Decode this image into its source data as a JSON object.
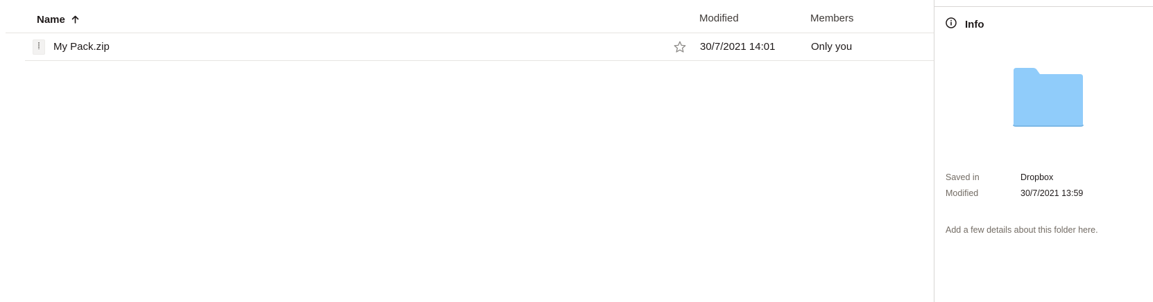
{
  "list": {
    "columns": {
      "name": "Name",
      "modified": "Modified",
      "members": "Members"
    },
    "sort": {
      "column": "name",
      "direction": "ascending",
      "icon": "arrow-up-icon"
    },
    "files": [
      {
        "name": "My Pack.zip",
        "icon": "zip-file-icon",
        "modified": "30/7/2021 14:01",
        "members": "Only you",
        "starred": false
      }
    ]
  },
  "info_panel": {
    "title": "Info",
    "title_icon": "info-icon",
    "folder_icon": "folder-icon",
    "folder_color": "#90ccfa",
    "saved_in_label": "Saved in",
    "saved_in_value": "Dropbox",
    "modified_label": "Modified",
    "modified_value": "30/7/2021 13:59",
    "description_placeholder": "Add a few details about this folder here."
  }
}
